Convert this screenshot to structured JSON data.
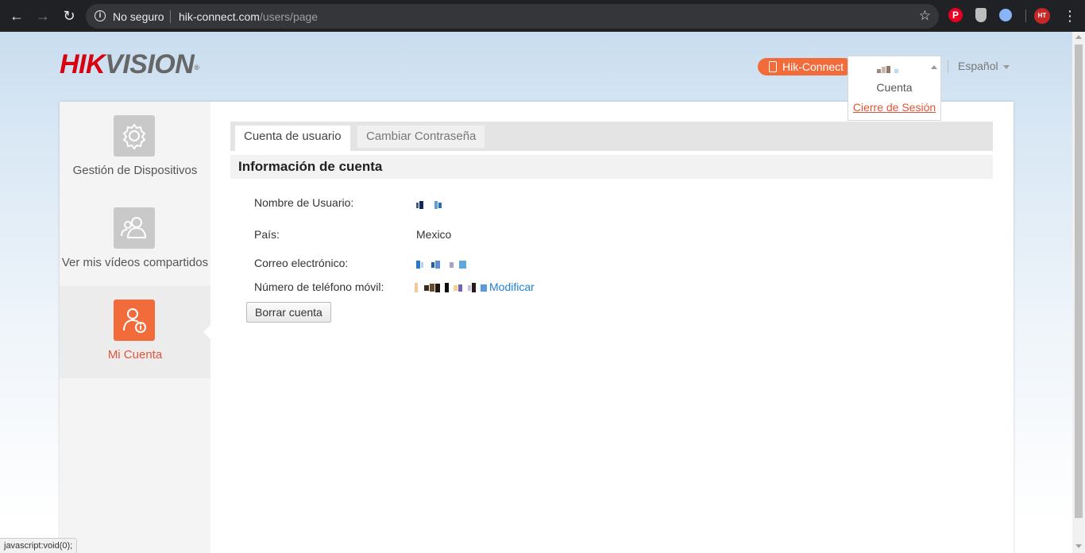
{
  "browser": {
    "security_label": "No seguro",
    "url_host": "hik-connect.com",
    "url_path": "/users/page",
    "extension_pin_label": "P",
    "profile_label": "HT"
  },
  "header": {
    "logo_hik": "HIK",
    "logo_vision": "VISION",
    "logo_mark": "®",
    "hikconnect_label": "Hik-Connect",
    "language_label": "Español"
  },
  "account_menu": {
    "account_label": "Cuenta",
    "logout_label": "Cierre de Sesión"
  },
  "sidebar": {
    "items": [
      {
        "label": "Gestión de Dispositivos",
        "icon": "gear-icon",
        "active": false
      },
      {
        "label": "Ver mis vídeos compartidos",
        "icon": "shared-users-icon",
        "active": false
      },
      {
        "label": "Mi Cuenta",
        "icon": "account-info-icon",
        "active": true
      }
    ]
  },
  "tabs": [
    {
      "label": "Cuenta de usuario",
      "active": true
    },
    {
      "label": "Cambiar Contraseña",
      "active": false
    }
  ],
  "section_title": "Información de cuenta",
  "fields": {
    "username_label": "Nombre de Usuario:",
    "country_label": "País:",
    "country_value": "Mexico",
    "email_label": "Correo electrónico:",
    "phone_label": "Número de teléfono móvil:",
    "modify_label": "Modificar"
  },
  "delete_account_label": "Borrar cuenta",
  "status_bar_text": "javascript:void(0);",
  "colors": {
    "brand_red": "#d7000f",
    "accent_orange": "#f26b3a",
    "link_blue": "#1f7ed6"
  }
}
